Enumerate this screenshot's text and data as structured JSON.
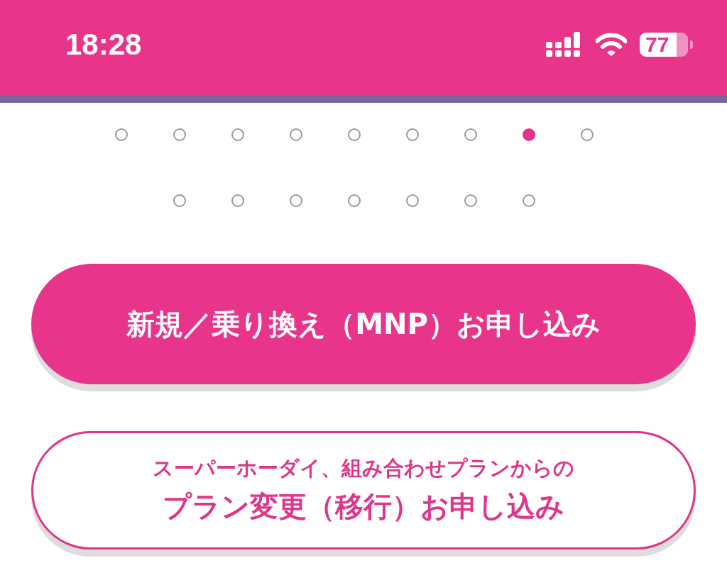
{
  "status_bar": {
    "time": "18:28",
    "battery": "77"
  },
  "pager": {
    "dots": [
      {
        "selected": false
      },
      {
        "selected": false
      },
      {
        "selected": false
      },
      {
        "selected": false
      },
      {
        "selected": false
      },
      {
        "selected": false
      },
      {
        "selected": false
      },
      {
        "selected": true
      },
      {
        "selected": false
      },
      {
        "selected": false
      },
      {
        "selected": false
      },
      {
        "selected": false
      },
      {
        "selected": false
      },
      {
        "selected": false
      },
      {
        "selected": false
      },
      {
        "selected": false
      }
    ]
  },
  "buttons": [
    {
      "kind": "primary",
      "lines": [
        "新規／乗り換え（MNP）お申し込み"
      ]
    },
    {
      "kind": "outline",
      "lines": [
        "スーパーホーダイ、組み合わせプランからの",
        "プラン変更（移行）お申し込み"
      ]
    }
  ]
}
